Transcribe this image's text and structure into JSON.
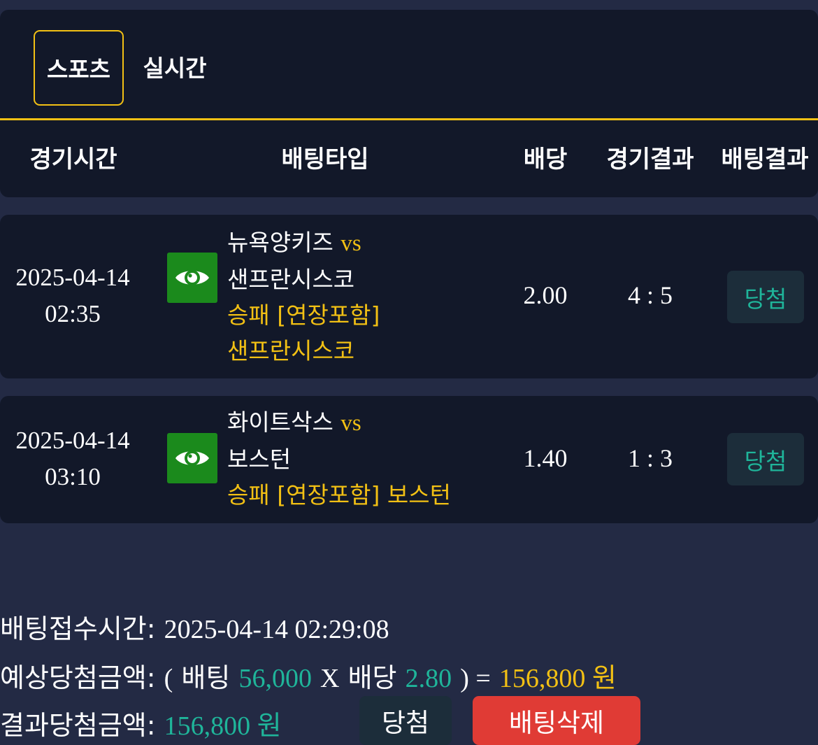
{
  "tabs": [
    {
      "label": "스포츠",
      "active": true
    },
    {
      "label": "실시간",
      "active": false
    }
  ],
  "columns": [
    "경기시간",
    "배팅타입",
    "배당",
    "경기결과",
    "배팅결과"
  ],
  "rows": [
    {
      "date": "2025-04-14",
      "time": "02:35",
      "home": "뉴욕양키즈",
      "vs": "vs",
      "away": "샌프란시스코",
      "pick": "승패 [연장포함]",
      "pick_team": "샌프란시스코",
      "odds": "2.00",
      "score": "4 : 5",
      "result": "당첨",
      "icon": "eye-icon"
    },
    {
      "date": "2025-04-14",
      "time": "03:10",
      "home": "화이트삭스",
      "vs": "vs",
      "away": "보스턴",
      "pick": "승패 [연장포함]",
      "pick_team": "보스턴",
      "odds": "1.40",
      "score": "1 : 3",
      "result": "당첨",
      "icon": "eye-icon"
    }
  ],
  "summary": {
    "received_label": "배팅접수시간:",
    "received_value": "2025-04-14 02:29:08",
    "expected_label": "예상당첨금액:",
    "open_paren": "(",
    "bet_label": "배팅",
    "bet_amount": "56,000",
    "times": "X",
    "odds_label": "배당",
    "total_odds": "2.80",
    "close_paren_eq": ") =",
    "expected_amount": "156,800 원",
    "result_label": "결과당첨금액:",
    "result_amount": "156,800 원",
    "win_button": "당첨",
    "delete_button": "배팅삭제"
  },
  "colors": {
    "background": "#232a44",
    "panel": "#121829",
    "accent_yellow": "#f2c014",
    "win_green": "#1fb59a",
    "eye_button": "#1b8a1c",
    "delete_red": "#e03b35"
  }
}
